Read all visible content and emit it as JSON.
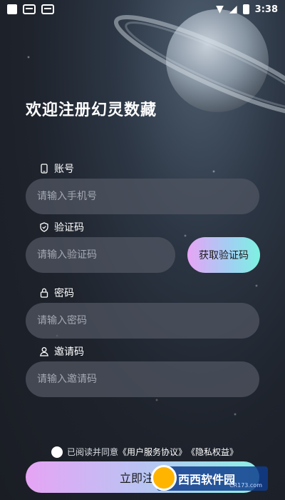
{
  "status_bar": {
    "time": "3:38"
  },
  "title": "欢迎注册幻灵数藏",
  "fields": {
    "account": {
      "label": "账号",
      "placeholder": "请输入手机号"
    },
    "code": {
      "label": "验证码",
      "placeholder": "请输入验证码",
      "button": "获取验证码"
    },
    "password": {
      "label": "密码",
      "placeholder": "请输入密码"
    },
    "invite": {
      "label": "邀请码",
      "placeholder": "请输入邀请码"
    }
  },
  "agreement": {
    "prefix": "已阅读并同意",
    "terms": "《用户服务协议》",
    "privacy": "《隐私权益》"
  },
  "register_button": "立即注册",
  "watermark": {
    "text": "西西软件园",
    "sub": "CR173.com"
  }
}
